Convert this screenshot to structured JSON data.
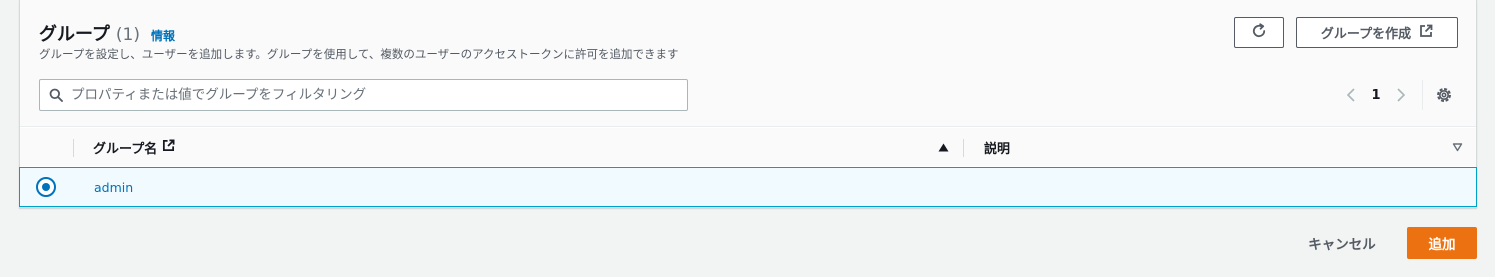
{
  "header": {
    "title": "グループ",
    "count": "(1)",
    "info_link": "情報",
    "description": "グループを設定し、ユーザーを追加します。グループを使用して、複数のユーザーのアクセストークンに許可を追加できます",
    "create_label": "グループを作成"
  },
  "search": {
    "placeholder": "プロパティまたは値でグループをフィルタリング",
    "value": ""
  },
  "pagination": {
    "current_page": "1"
  },
  "table": {
    "columns": [
      {
        "label": "グループ名",
        "sort": "ascending"
      },
      {
        "label": "説明",
        "sort": "none"
      }
    ],
    "rows": [
      {
        "name": "admin",
        "description": "",
        "selected": true
      }
    ]
  },
  "footer": {
    "cancel_label": "キャンセル",
    "add_label": "追加"
  },
  "icons": {
    "refresh": "refresh-icon",
    "external": "external-link-icon",
    "search": "search-icon",
    "prev": "chevron-left-icon",
    "next": "chevron-right-icon",
    "settings": "gear-icon",
    "sort_asc": "sort-ascending-icon",
    "sort_none": "sort-descending-outline-icon"
  },
  "colors": {
    "link": "#0073bb",
    "primary_button": "#ec7211",
    "selected_row_bg": "#f1faff",
    "selected_row_border": "#00a1c9"
  }
}
